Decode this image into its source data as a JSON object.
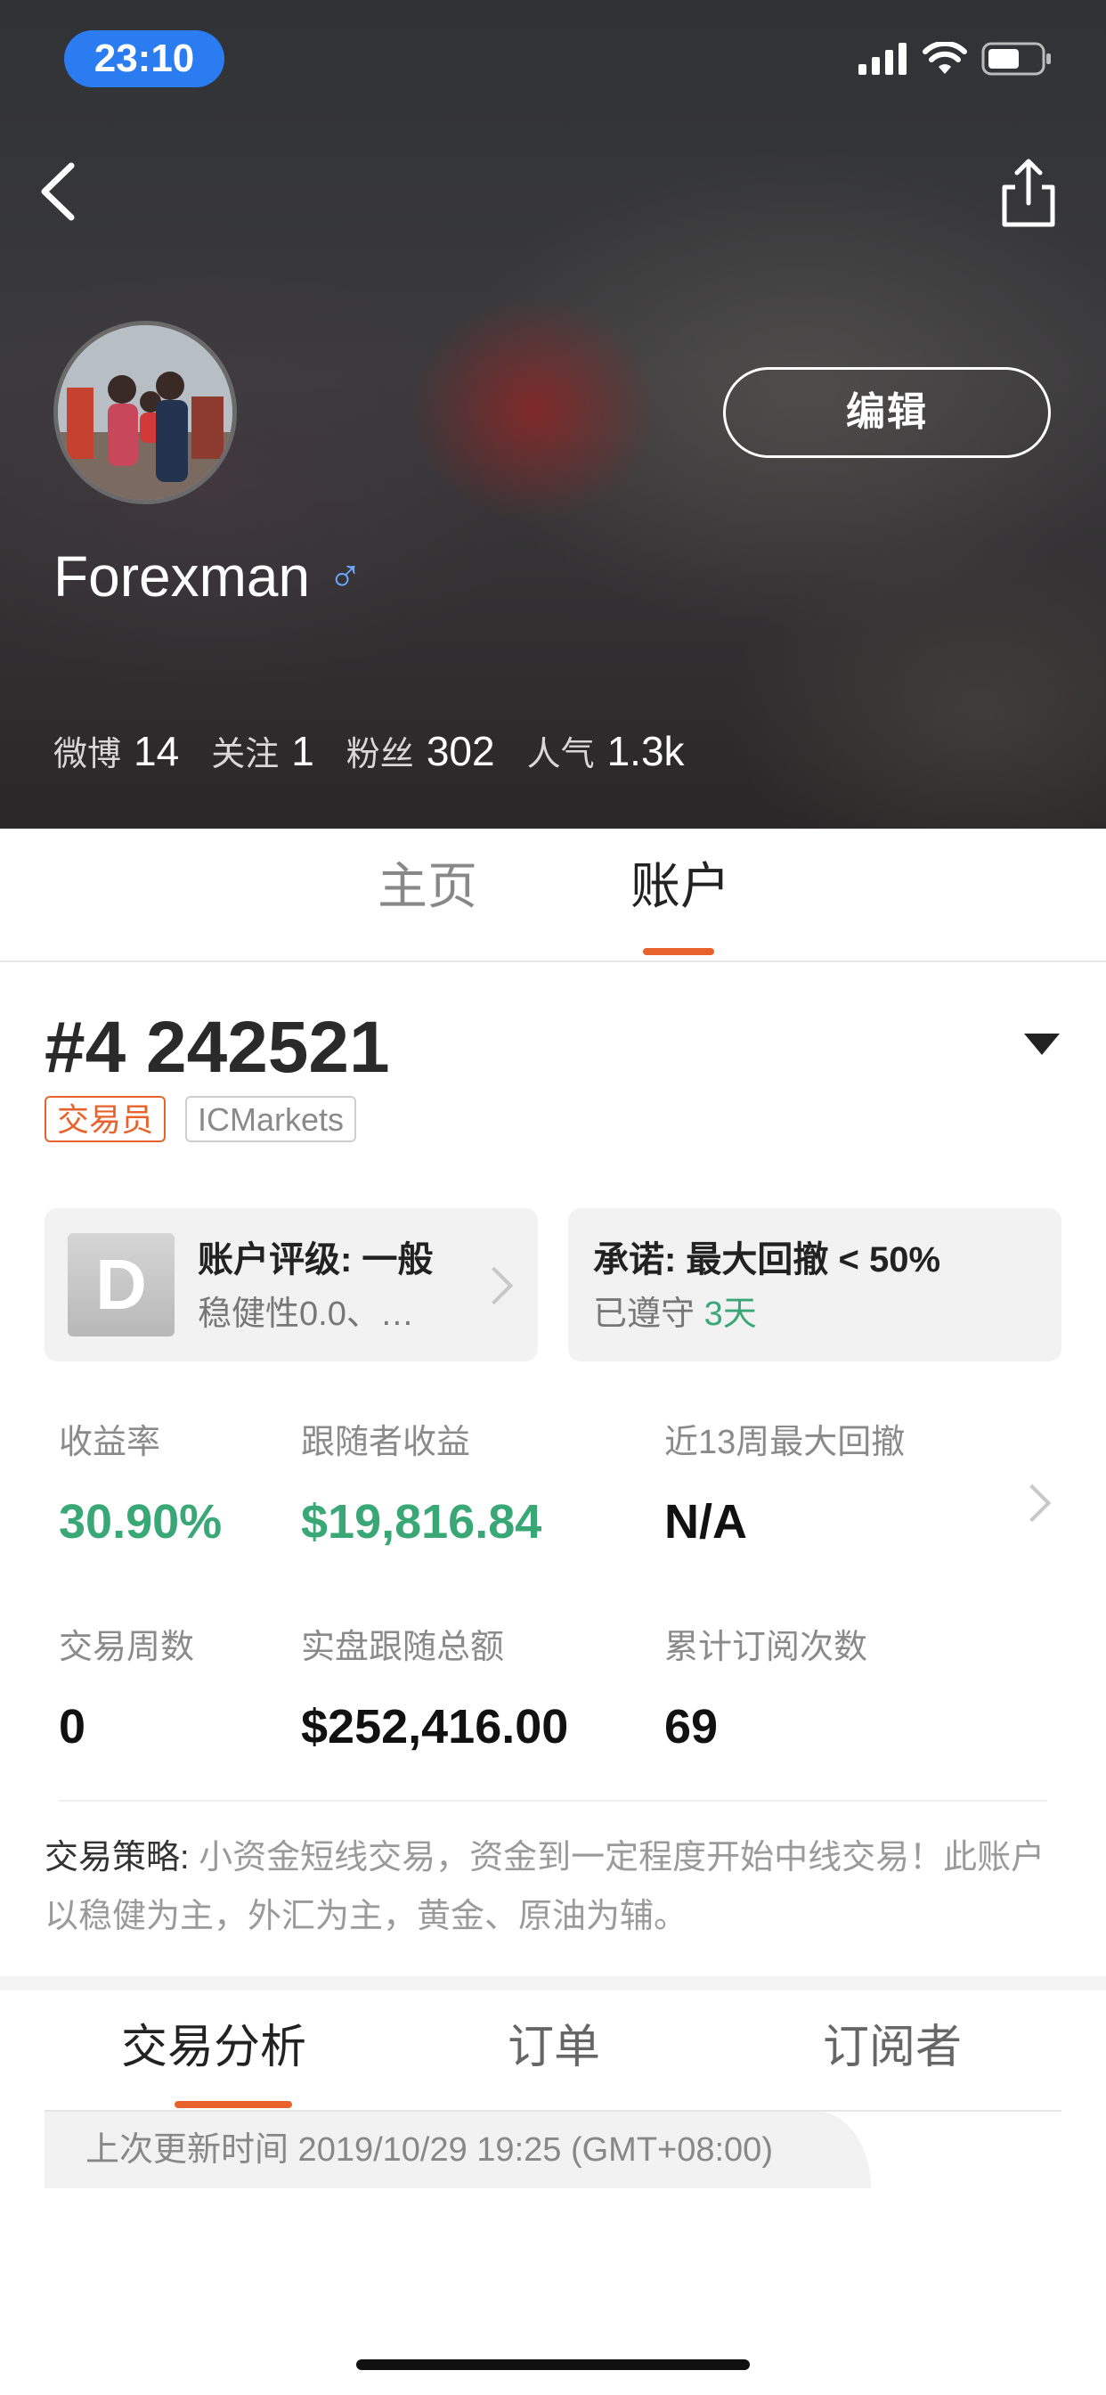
{
  "status_bar": {
    "time": "23:10"
  },
  "profile": {
    "username": "Forexman",
    "gender_symbol": "♂",
    "edit_label": "编辑",
    "stats": [
      {
        "label": "微博",
        "value": "14"
      },
      {
        "label": "关注",
        "value": "1"
      },
      {
        "label": "粉丝",
        "value": "302"
      },
      {
        "label": "人气",
        "value": "1.3k"
      }
    ]
  },
  "main_tabs": [
    {
      "label": "主页",
      "active": false
    },
    {
      "label": "账户",
      "active": true
    }
  ],
  "account": {
    "title": "#4 242521",
    "role_tag": "交易员",
    "broker_tag": "ICMarkets",
    "rating_card": {
      "badge": "D",
      "title": "账户评级: 一般",
      "subtitle": "稳健性0.0、…"
    },
    "promise_card": {
      "title": "承诺: 最大回撤 < 50%",
      "subtitle_prefix": "已遵守",
      "days": "3天"
    },
    "metrics": [
      {
        "label": "收益率",
        "value": "30.90%"
      },
      {
        "label": "跟随者收益",
        "value": "$19,816.84"
      },
      {
        "label": "近13周最大回撤",
        "value": "N/A"
      },
      {
        "label": "交易周数",
        "value": "0"
      },
      {
        "label": "实盘跟随总额",
        "value": "$252,416.00"
      },
      {
        "label": "累计订阅次数",
        "value": "69"
      }
    ],
    "strategy_label": "交易策略:",
    "strategy_text": " 小资金短线交易，资金到一定程度开始中线交易！此账户以稳健为主，外汇为主，黄金、原油为辅。"
  },
  "sub_tabs": [
    {
      "label": "交易分析",
      "active": true
    },
    {
      "label": "订单",
      "active": false
    },
    {
      "label": "订阅者",
      "active": false
    }
  ],
  "update_text": "上次更新时间 2019/10/29 19:25 (GMT+08:00)",
  "colors": {
    "accent": "#e8632b",
    "positive": "#3aa776",
    "status_pill": "#2a7cf0"
  }
}
